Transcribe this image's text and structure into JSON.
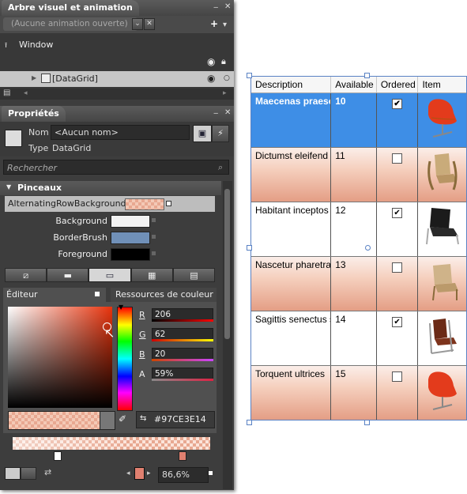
{
  "objects_panel": {
    "title": "Arbre visuel et animation",
    "storyboard": "(Aucune animation ouverte)",
    "root": "Window",
    "node": "[DataGrid]"
  },
  "properties_panel": {
    "title": "Propriétés",
    "name_label": "Nom",
    "name_value": "<Aucun nom>",
    "type_label": "Type",
    "type_value": "DataGrid",
    "search_placeholder": "Rechercher",
    "brushes_section": "Pinceaux",
    "brushes": [
      {
        "label": "AlternatingRowBackground",
        "color": "#97CE3E14"
      },
      {
        "label": "Background",
        "color": "#f2f2f2"
      },
      {
        "label": "BorderBrush",
        "color": "#7090b8"
      },
      {
        "label": "Foreground",
        "color": "#000000"
      }
    ],
    "editor_tab": "Éditeur",
    "resources_tab": "Ressources de couleur",
    "r_label": "R",
    "r_value": "206",
    "g_label": "G",
    "g_value": "62",
    "b_label": "B",
    "b_value": "20",
    "a_label": "A",
    "a_value": "59%",
    "hex_value": "#97CE3E14",
    "zoom_value": "86,6%"
  },
  "datagrid": {
    "columns": [
      "Description",
      "Available",
      "Ordered",
      "Item"
    ],
    "rows": [
      {
        "description": "Maecenas praesent",
        "available": "10",
        "ordered": true,
        "item": "red-chair"
      },
      {
        "description": "Dictumst eleifend",
        "available": "11",
        "ordered": false,
        "item": "wood-chair"
      },
      {
        "description": "Habitant inceptos",
        "available": "12",
        "ordered": true,
        "item": "black-chair"
      },
      {
        "description": "Nascetur pharetra",
        "available": "13",
        "ordered": false,
        "item": "wood-chair"
      },
      {
        "description": "Sagittis senectus s",
        "available": "14",
        "ordered": true,
        "item": "frame-chair"
      },
      {
        "description": "Torquent ultrices",
        "available": "15",
        "ordered": false,
        "item": "red-chair"
      }
    ]
  }
}
